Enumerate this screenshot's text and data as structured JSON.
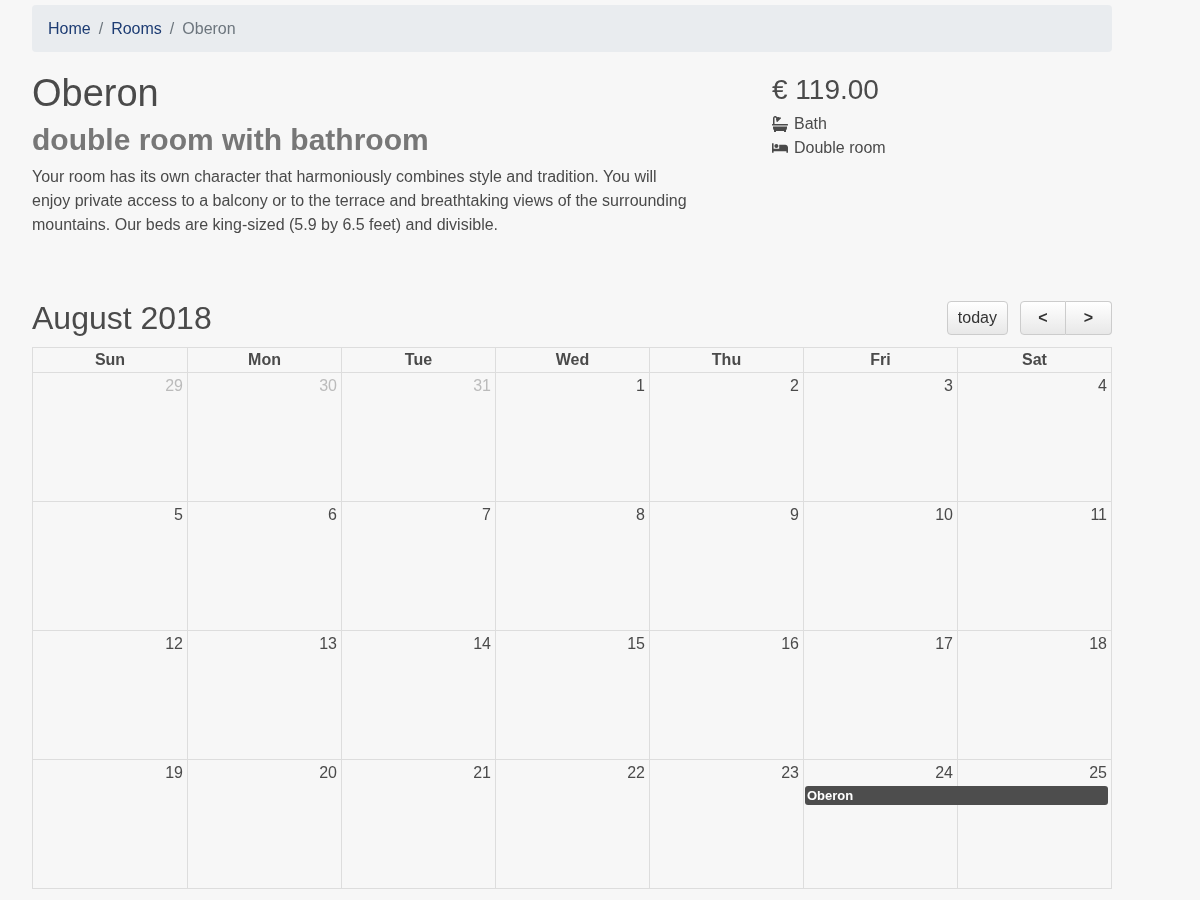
{
  "breadcrumb_separator": "/",
  "breadcrumb": [
    {
      "label": "Home",
      "current": false
    },
    {
      "label": "Rooms",
      "current": false
    },
    {
      "label": "Oberon",
      "current": true
    }
  ],
  "room": {
    "name": "Oberon",
    "subtitle": "double room with bathroom",
    "description": "Your room has its own character that harmoniously combines style and tradition. You will enjoy private access to a balcony or to the terrace and breathtaking views of the surrounding mountains. Our beds are king-sized (5.9 by 6.5 feet) and divisible."
  },
  "price": "€ 119.00",
  "features": [
    {
      "kind": "bath",
      "label": "Bath"
    },
    {
      "kind": "bed",
      "label": "Double room"
    }
  ],
  "calendar": {
    "title": "August 2018",
    "today_button": "today",
    "prev_button": "<",
    "next_button": ">",
    "weekdays": [
      "Sun",
      "Mon",
      "Tue",
      "Wed",
      "Thu",
      "Fri",
      "Sat"
    ],
    "weeks": [
      {
        "days": [
          {
            "num": "29",
            "other_month": true
          },
          {
            "num": "30",
            "other_month": true
          },
          {
            "num": "31",
            "other_month": true
          },
          {
            "num": "1",
            "other_month": false
          },
          {
            "num": "2",
            "other_month": false
          },
          {
            "num": "3",
            "other_month": false
          },
          {
            "num": "4",
            "other_month": false
          }
        ]
      },
      {
        "days": [
          {
            "num": "5",
            "other_month": false
          },
          {
            "num": "6",
            "other_month": false
          },
          {
            "num": "7",
            "other_month": false
          },
          {
            "num": "8",
            "other_month": false
          },
          {
            "num": "9",
            "other_month": false
          },
          {
            "num": "10",
            "other_month": false
          },
          {
            "num": "11",
            "other_month": false
          }
        ]
      },
      {
        "days": [
          {
            "num": "12",
            "other_month": false
          },
          {
            "num": "13",
            "other_month": false
          },
          {
            "num": "14",
            "other_month": false
          },
          {
            "num": "15",
            "other_month": false
          },
          {
            "num": "16",
            "other_month": false
          },
          {
            "num": "17",
            "other_month": false
          },
          {
            "num": "18",
            "other_month": false
          }
        ]
      },
      {
        "days": [
          {
            "num": "19",
            "other_month": false
          },
          {
            "num": "20",
            "other_month": false
          },
          {
            "num": "21",
            "other_month": false
          },
          {
            "num": "22",
            "other_month": false
          },
          {
            "num": "23",
            "other_month": false
          },
          {
            "num": "24",
            "other_month": false,
            "event": "Oberon"
          },
          {
            "num": "25",
            "other_month": false,
            "event_continued": true
          }
        ]
      }
    ]
  }
}
